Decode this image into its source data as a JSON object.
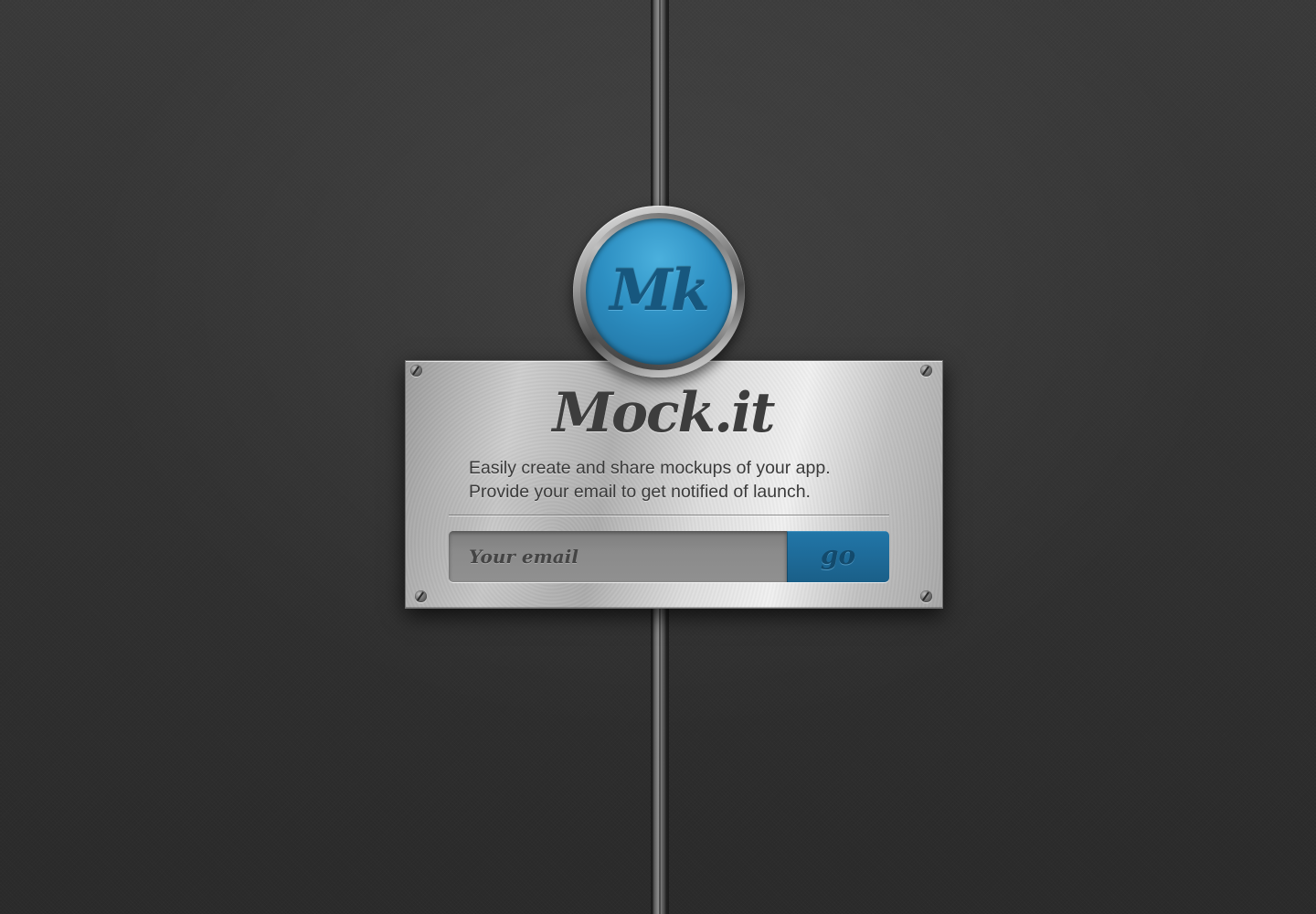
{
  "logo": {
    "badge_text": "Mk"
  },
  "plate": {
    "title": "Mock.it",
    "description_line_1": "Easily create and share mockups of your app.",
    "description_line_2": "Provide your email to get notified of launch."
  },
  "form": {
    "email_placeholder": "Your email",
    "email_value": "",
    "submit_label": "go"
  },
  "colors": {
    "accent_blue": "#2176a8",
    "background": "#333333",
    "plate_metal": "#cfcfcf",
    "title_text": "#3d3d3d"
  }
}
